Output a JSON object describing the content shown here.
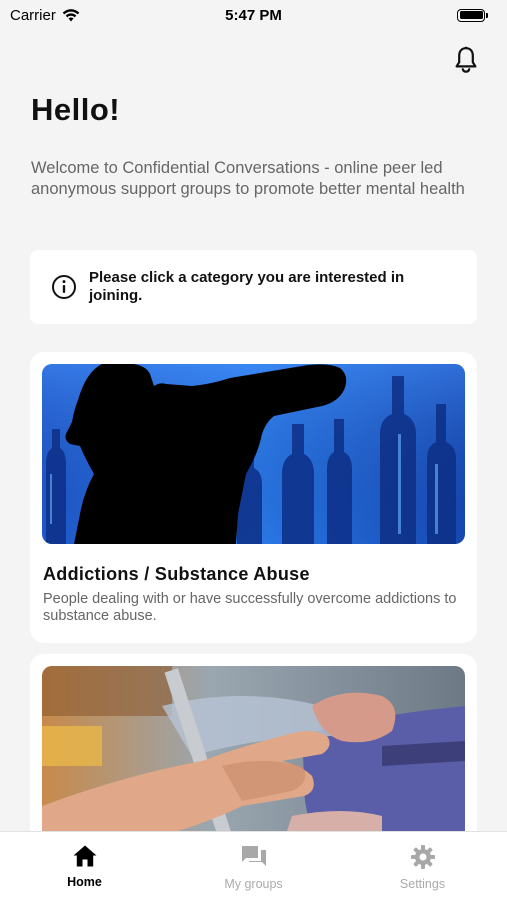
{
  "status_bar": {
    "carrier": "Carrier",
    "time": "5:47 PM",
    "battery_level": 1.0
  },
  "header": {
    "bell_icon": "bell-icon",
    "greeting": "Hello!",
    "intro": "Welcome to Confidential Conversations - online peer led anonymous support groups to promote better mental health"
  },
  "notice": {
    "icon": "info-icon",
    "text": "Please click a category you are interested in joining."
  },
  "categories": [
    {
      "title": "Addictions / Substance Abuse",
      "description": "People dealing with or have successfully overcome addictions to substance abuse."
    },
    {
      "title": "",
      "description": ""
    }
  ],
  "tabbar": {
    "tabs": [
      {
        "label": "Home",
        "icon": "home-icon",
        "active": true
      },
      {
        "label": "My groups",
        "icon": "chat-icon",
        "active": false
      },
      {
        "label": "Settings",
        "icon": "gear-icon",
        "active": false
      }
    ]
  },
  "colors": {
    "background": "#f4f4f4",
    "card": "#ffffff",
    "muted_text": "#666666",
    "inactive_tab": "#aaaaaa"
  }
}
